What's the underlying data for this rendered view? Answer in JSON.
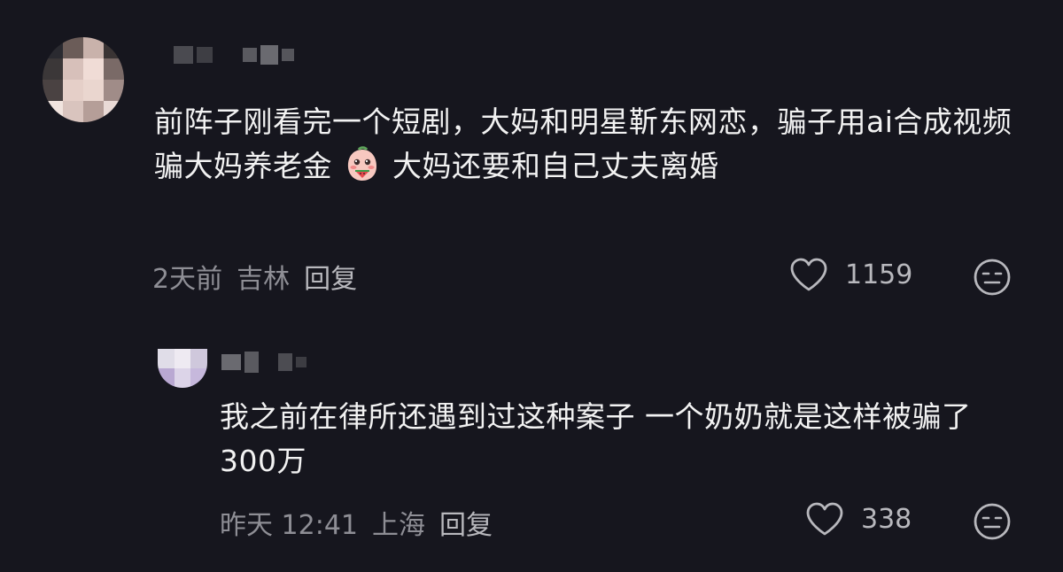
{
  "comments": [
    {
      "text_before_emoji": "前阵子刚看完一个短剧，大妈和明星靳东网恋，骗子用ai合成视频骗大妈养老金",
      "text_after_emoji": "大妈还要和自己丈夫离婚",
      "emoji": "crying-watermelon-sticker",
      "time": "2天前",
      "location": "吉林",
      "reply_label": "回复",
      "likes": "1159"
    },
    {
      "text": "我之前在律所还遇到过这种案子 一个奶奶就是这样被骗了300万",
      "time": "昨天 12:41",
      "location": "上海",
      "reply_label": "回复",
      "likes": "338"
    }
  ],
  "icons": {
    "like": "heart-outline-icon",
    "reaction": "neutral-face-icon"
  },
  "colors": {
    "background": "#16161e",
    "text": "#f2f2f2",
    "meta": "#8e8e95"
  }
}
